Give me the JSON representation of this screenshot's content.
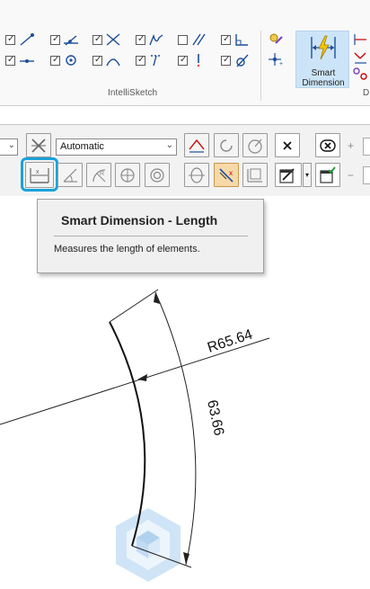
{
  "ribbon": {
    "group_label": "IntelliSketch",
    "smart_dimension_label_line1": "Smart",
    "smart_dimension_label_line2": "Dimension",
    "next_group_label": "D",
    "checkboxes_checked": [
      true,
      true,
      true,
      true,
      false,
      true,
      true,
      true,
      true,
      true,
      true,
      true
    ],
    "icons": [
      "line-endpoint-icon",
      "point-on-element-icon",
      "intersection-icon",
      "curve-icon",
      "parallel-icon",
      "perpendicular-corner-icon",
      "midpoint-icon",
      "center-icon",
      "tangent-arc-icon",
      "silhouette-icon",
      "vertical-icon",
      "tangent-icon"
    ]
  },
  "command_bar": {
    "mode_select_value": "Automatic",
    "plus_symbol": "+",
    "minus_symbol": "−"
  },
  "tooltip": {
    "title": "Smart Dimension - Length",
    "description": "Measures the length of elements."
  },
  "drawing": {
    "radius_label": "R65.64",
    "arc_length_label": "63.66"
  },
  "colors": {
    "highlight_ring": "#1aa2d9",
    "active_button": "#f7d9a8",
    "smart_dimension_button": "#cce4f7",
    "watermark": "#bcd9f3"
  }
}
